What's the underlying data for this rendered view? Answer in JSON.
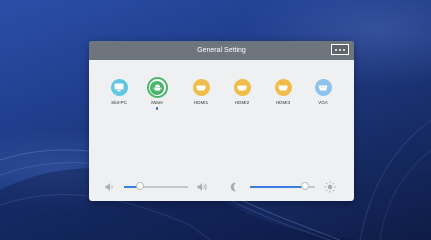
{
  "panel": {
    "title": "General Setting",
    "menu_icon": "more-dots-icon"
  },
  "sources": [
    {
      "label": "Slot-PC",
      "icon": "monitor-icon",
      "color": "#5fc7e3",
      "selected": false
    },
    {
      "label": "iWare",
      "icon": "android-icon",
      "color": "#4bb56a",
      "selected": true
    },
    {
      "label": "HDMI1",
      "icon": "hdmi-port-icon",
      "color": "#f0bd4a",
      "selected": false
    },
    {
      "label": "HDMI2",
      "icon": "hdmi-port-icon",
      "color": "#f0bd4a",
      "selected": false
    },
    {
      "label": "HDMI3",
      "icon": "hdmi-port-icon",
      "color": "#f0bd4a",
      "selected": false
    },
    {
      "label": "VGA",
      "icon": "vga-port-icon",
      "color": "#8fc3ee",
      "selected": false
    }
  ],
  "volume": {
    "level": 0.25,
    "min_icon": "speaker-low-icon",
    "max_icon": "speaker-high-icon"
  },
  "brightness": {
    "level": 0.85,
    "min_icon": "moon-icon",
    "max_icon": "sun-icon"
  },
  "colors": {
    "accent": "#3a7de0",
    "header": "#6f757d",
    "panel": "#eef0f2"
  }
}
